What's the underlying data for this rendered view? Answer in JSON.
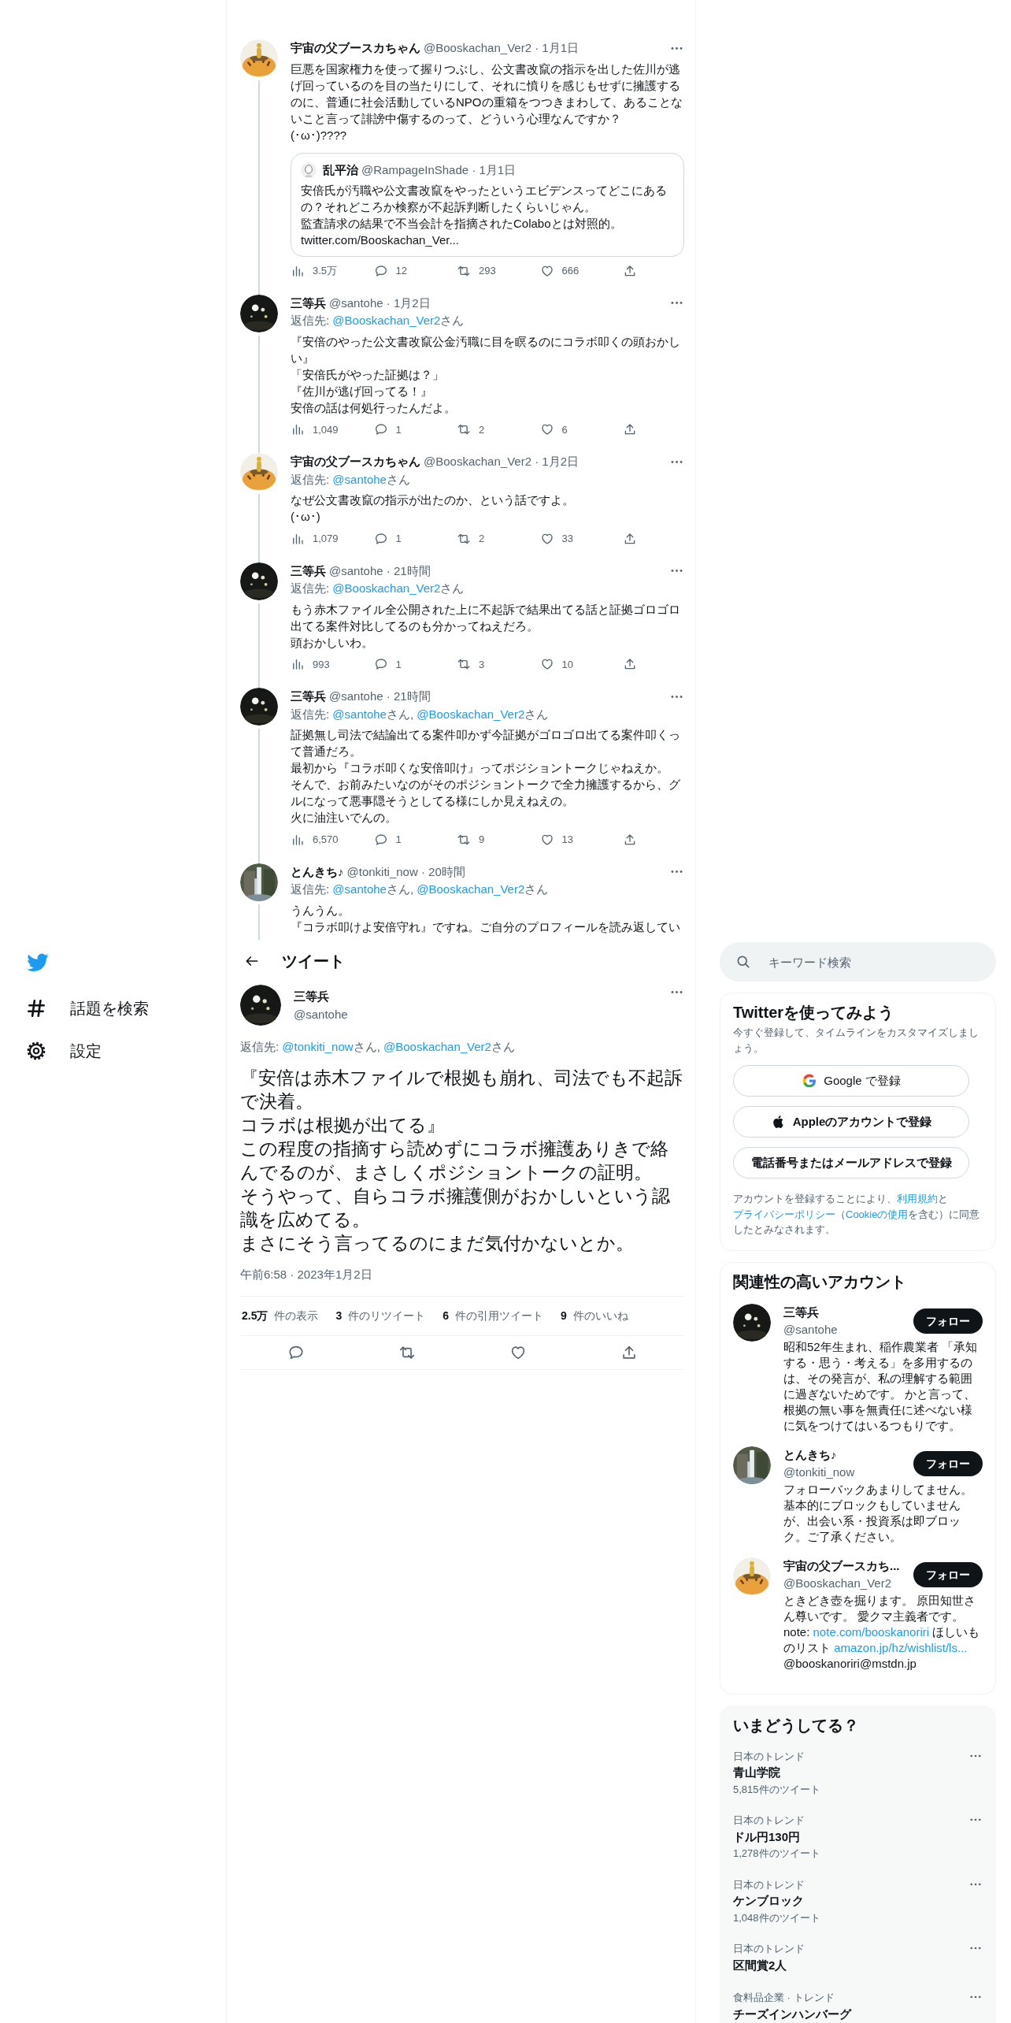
{
  "sidebar": {
    "items": [
      {
        "kind": "explore",
        "label": "話題を検索"
      },
      {
        "kind": "settings",
        "label": "設定"
      }
    ]
  },
  "thread": [
    {
      "avatar": {
        "kind": "mascot"
      },
      "name": "宇宙の父ブースカちゃん",
      "meta": "@Booskachan_Ver2 · 1月1日",
      "paragraphs": [
        "巨悪を国家権力を使って握りつぶし、公文書改竄の指示を出した佐川が逃げ回っているのを目の当たりにして、それに憤りを感じもせずに擁護するのに、普通に社会活動しているNPOの重箱をつつきまわして、あることないこと言って誹謗中傷するのって、どういう心理なんですか？",
        "(･ω･)????"
      ],
      "quote": {
        "avatar": {
          "kind": "sketch"
        },
        "name": "乱平治",
        "meta": "@RampageInShade · 1月1日",
        "paragraphs": [
          "安倍氏が汚職や公文書改竄をやったというエビデンスってどこにあるの？それどころか検察が不起訴判断したくらいじゃん。",
          "監査請求の結果で不当会計を指摘されたColaboとは対照的。",
          "twitter.com/Booskachan_Ver..."
        ]
      },
      "actions": [
        {
          "kind": "views",
          "count": "3.5万"
        },
        {
          "kind": "reply",
          "count": "12"
        },
        {
          "kind": "retweet",
          "count": "293"
        },
        {
          "kind": "like",
          "count": "666"
        },
        {
          "kind": "share"
        }
      ]
    },
    {
      "avatar": {
        "kind": "night"
      },
      "name": "三等兵",
      "meta": "@santohe · 1月2日",
      "reply": [
        {
          "text": "返信先: ",
          "link": false
        },
        {
          "text": "@Booskachan_Ver2",
          "link": true
        },
        {
          "text": "さん",
          "link": false
        }
      ],
      "paragraphs": [
        "『安倍のやった公文書改竄公金汚職に目を瞑るのにコラボ叩くの頭おかしい』",
        "「安倍氏がやった証拠は？」",
        "『佐川が逃げ回ってる！』",
        "安倍の話は何処行ったんだよ。"
      ],
      "actions": [
        {
          "kind": "views",
          "count": "1,049"
        },
        {
          "kind": "reply",
          "count": "1"
        },
        {
          "kind": "retweet",
          "count": "2"
        },
        {
          "kind": "like",
          "count": "6"
        },
        {
          "kind": "share"
        }
      ]
    },
    {
      "avatar": {
        "kind": "mascot"
      },
      "name": "宇宙の父ブースカちゃん",
      "meta": "@Booskachan_Ver2 · 1月2日",
      "reply": [
        {
          "text": "返信先: ",
          "link": false
        },
        {
          "text": "@santohe",
          "link": true
        },
        {
          "text": "さん",
          "link": false
        }
      ],
      "paragraphs": [
        "なぜ公文書改竄の指示が出たのか、という話ですよ。",
        "(･ω･)"
      ],
      "actions": [
        {
          "kind": "views",
          "count": "1,079"
        },
        {
          "kind": "reply",
          "count": "1"
        },
        {
          "kind": "retweet",
          "count": "2"
        },
        {
          "kind": "like",
          "count": "33"
        },
        {
          "kind": "share"
        }
      ]
    },
    {
      "avatar": {
        "kind": "night"
      },
      "name": "三等兵",
      "meta": "@santohe · 21時間",
      "reply": [
        {
          "text": "返信先: ",
          "link": false
        },
        {
          "text": "@Booskachan_Ver2",
          "link": true
        },
        {
          "text": "さん",
          "link": false
        }
      ],
      "paragraphs": [
        "もう赤木ファイル全公開された上に不起訴で結果出てる話と証拠ゴロゴロ出てる案件対比してるのも分かってねえだろ。",
        "頭おかしいわ。"
      ],
      "actions": [
        {
          "kind": "views",
          "count": "993"
        },
        {
          "kind": "reply",
          "count": "1"
        },
        {
          "kind": "retweet",
          "count": "3"
        },
        {
          "kind": "like",
          "count": "10"
        },
        {
          "kind": "share"
        }
      ]
    },
    {
      "avatar": {
        "kind": "night"
      },
      "name": "三等兵",
      "meta": "@santohe · 21時間",
      "reply": [
        {
          "text": "返信先: ",
          "link": false
        },
        {
          "text": "@santohe",
          "link": true
        },
        {
          "text": "さん, ",
          "link": false
        },
        {
          "text": "@Booskachan_Ver2",
          "link": true
        },
        {
          "text": "さん",
          "link": false
        }
      ],
      "paragraphs": [
        "証拠無し司法で結論出てる案件叩かず今証拠がゴロゴロ出てる案件叩くって普通だろ。",
        "最初から『コラボ叩くな安倍叩け』ってポジショントークじゃねえか。",
        "そんで、お前みたいなのがそのポジショントークで全力擁護するから、グルになって悪事隠そうとしてる様にしか見えねえの。",
        "火に油注いでんの。"
      ],
      "actions": [
        {
          "kind": "views",
          "count": "6,570"
        },
        {
          "kind": "reply",
          "count": "1"
        },
        {
          "kind": "retweet",
          "count": "9"
        },
        {
          "kind": "like",
          "count": "13"
        },
        {
          "kind": "share"
        }
      ]
    },
    {
      "avatar": {
        "kind": "waterfall"
      },
      "name": "とんきち♪",
      "meta": "@tonkiti_now · 20時間",
      "reply": [
        {
          "text": "返信先: ",
          "link": false
        },
        {
          "text": "@santohe",
          "link": true
        },
        {
          "text": "さん, ",
          "link": false
        },
        {
          "text": "@Booskachan_Ver2",
          "link": true
        },
        {
          "text": "さん",
          "link": false
        }
      ],
      "paragraphs": [
        "うんうん。",
        "『コラボ叩けよ安倍守れ』ですね。ご自分のプロフィールを読み返してい"
      ]
    }
  ],
  "header": {
    "title": "ツイート"
  },
  "main_tweet": {
    "avatar": {
      "kind": "night"
    },
    "name": "三等兵",
    "handle": "@santohe",
    "reply": [
      {
        "text": "返信先: ",
        "link": false
      },
      {
        "text": "@tonkiti_now",
        "link": true
      },
      {
        "text": "さん, ",
        "link": false
      },
      {
        "text": "@Booskachan_Ver2",
        "link": true
      },
      {
        "text": "さん",
        "link": false
      }
    ],
    "paragraphs": [
      "『安倍は赤木ファイルで根拠も崩れ、司法でも不起訴で決着。",
      "コラボは根拠が出てる』",
      "この程度の指摘すら読めずにコラボ擁護ありきで絡んでるのが、まさしくポジショントークの証明。",
      "そうやって、自らコラボ擁護側がおかしいという認識を広めてる。",
      "まさにそう言ってるのにまだ気付かないとか。"
    ],
    "timestamp": "午前6:58 · 2023年1月2日",
    "stats": [
      {
        "count": "2.5万",
        "label": "件の表示"
      },
      {
        "count": "3",
        "label": "件のリツイート"
      },
      {
        "count": "6",
        "label": "件の引用ツイート"
      },
      {
        "count": "9",
        "label": "件のいいね"
      }
    ],
    "actions": [
      {
        "kind": "reply"
      },
      {
        "kind": "retweet"
      },
      {
        "kind": "like"
      },
      {
        "kind": "share"
      }
    ]
  },
  "search": {
    "placeholder": "キーワード検索"
  },
  "signup": {
    "title": "Twitterを使ってみよう",
    "subtitle": "今すぐ登録して、タイムラインをカスタマイズしましょう。",
    "buttons": [
      {
        "kind": "google",
        "label": "Google で登録"
      },
      {
        "kind": "apple",
        "label": "Appleのアカウントで登録"
      },
      {
        "kind": "plain",
        "label": "電話番号またはメールアドレスで登録"
      }
    ],
    "legal": [
      {
        "text": "アカウントを登録することにより、",
        "link": false
      },
      {
        "text": "利用規約",
        "link": true
      },
      {
        "text": "と",
        "link": false
      },
      {
        "text": "プライバシーポリシー",
        "link": true
      },
      {
        "text": "（",
        "link": false
      },
      {
        "text": "Cookieの使用",
        "link": true
      },
      {
        "text": "を含む）に同意したとみなされます。",
        "link": false
      }
    ]
  },
  "who_to_follow": {
    "title": "関連性の高いアカウント",
    "accounts": [
      {
        "avatar": {
          "kind": "night"
        },
        "name": "三等兵",
        "handle": "@santohe",
        "button": "フォロー",
        "bio": [
          {
            "text": "昭和52年生まれ、稲作農業者 「承知する・思う・考える」を多用するのは、その発言が、私の理解する範囲に過ぎないためです。 かと言って、根拠の無い事を無責任に述べない様に気をつけてはいるつもりです。",
            "link": false
          }
        ]
      },
      {
        "avatar": {
          "kind": "waterfall"
        },
        "name": "とんきち♪",
        "handle": "@tonkiti_now",
        "button": "フォロー",
        "bio": [
          {
            "text": "フォローバックあまりしてません。基本的にブロックもしていませんが、出会い系・投資系は即ブロック。ご了承ください。",
            "link": false
          }
        ]
      },
      {
        "avatar": {
          "kind": "mascot"
        },
        "name": "宇宙の父ブースカち...",
        "handle": "@Booskachan_Ver2",
        "button": "フォロー",
        "bio": [
          {
            "text": "ときどき壺を掘ります。 原田知世さん尊いです。 愛クマ主義者です。 note: ",
            "link": false
          },
          {
            "text": "note.com/booskanoriri",
            "link": true
          },
          {
            "text": " ほしいものリスト ",
            "link": false
          },
          {
            "text": "amazon.jp/hz/wishlist/ls...",
            "link": true
          },
          {
            "text": " @booskanoriri@mstdn.jp",
            "link": false
          }
        ]
      }
    ]
  },
  "trends": {
    "title": "いまどうしてる？",
    "items": [
      {
        "context": "日本のトレンド",
        "title": "青山学院",
        "count": "5,815件のツイート"
      },
      {
        "context": "日本のトレンド",
        "title": "ドル円130円",
        "count": "1,278件のツイート"
      },
      {
        "context": "日本のトレンド",
        "title": "ケンブロック",
        "count": "1,048件のツイート"
      },
      {
        "context": "日本のトレンド",
        "title": "区間賞2人"
      },
      {
        "context": "食料品企業 · トレンド",
        "title": "チーズインハンバーグ"
      }
    ]
  }
}
